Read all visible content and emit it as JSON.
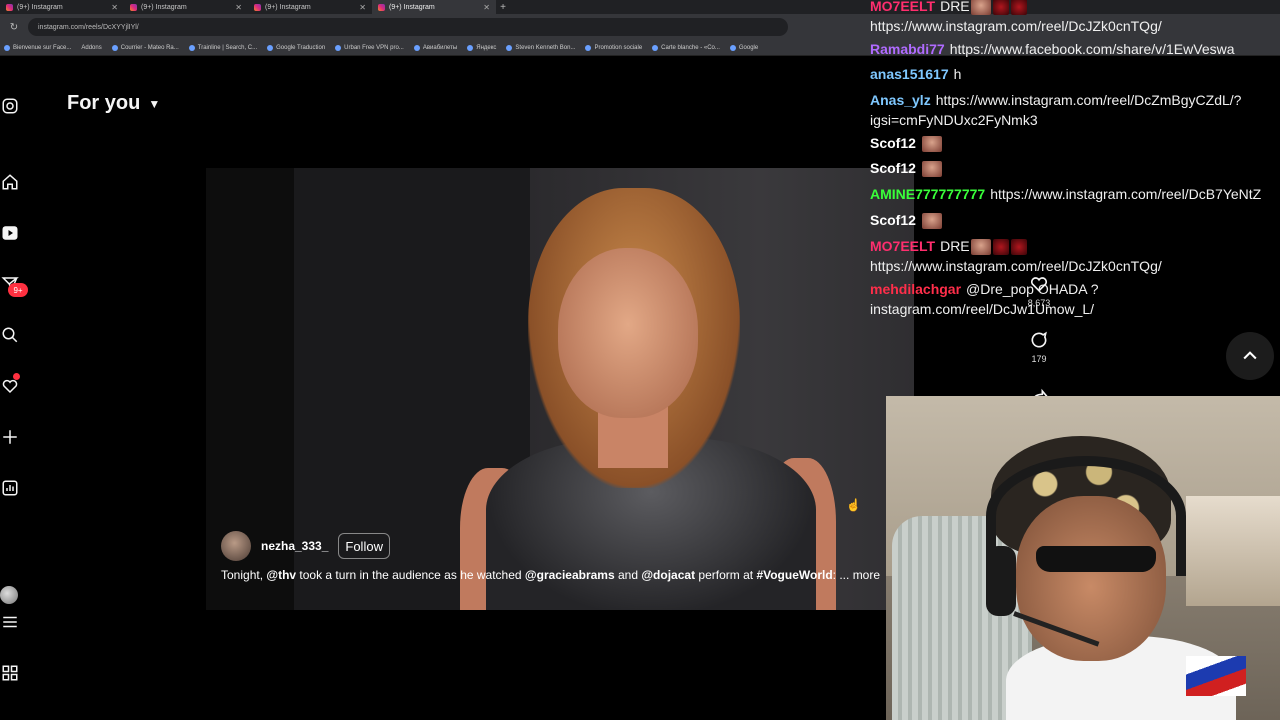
{
  "browser": {
    "tabs": [
      {
        "label": "(9+) Instagram"
      },
      {
        "label": "(9+) Instagram"
      },
      {
        "label": "(9+) Instagram"
      },
      {
        "label": "(9+) Instagram"
      }
    ],
    "new_tab": "+",
    "url": "instagram.com/reels/DcXYYjlIYl/",
    "bookmarks": [
      "Bienvenue sur Face...",
      "Addons",
      "Courrier - Mateo Ra...",
      "Trainline | Search, C...",
      "Google Traduction",
      "Urban Free VPN pro...",
      "Авиабилеты",
      "Яндекс",
      "Steven Kenneth Bon...",
      "Promotion sociale",
      "Carte blanche - «Co...",
      "Google"
    ]
  },
  "instagram": {
    "feed_title": "For you",
    "notification_badge": "9+",
    "post": {
      "username": "nezha_333_",
      "follow_label": "Follow",
      "caption": {
        "t1": "Tonight, ",
        "m1": "@thv",
        "t2": " took a turn in the audience as he watched ",
        "m2": "@gracieabrams",
        "t3": " and ",
        "m3": "@dojacat",
        "t4": " perform at ",
        "m4": "#VogueWorld",
        "t5": ": ... ",
        "more": "more"
      }
    },
    "actions": {
      "likes": "8,673",
      "comments": "179"
    }
  },
  "chat": [
    {
      "user": "MO7EELT",
      "color": "#ff2e6e",
      "msg": "DRE",
      "emotes": 3
    },
    {
      "user": "",
      "color": "#ffffff",
      "msg": "https://www.instagram.com/reel/DcJZk0cnTQg/",
      "emotes": 0
    },
    {
      "user": "Ramabdi77",
      "color": "#b06bff",
      "msg": "https://www.facebook.com/share/v/1EwVeswa",
      "emotes": 0
    },
    {
      "user": "anas151617",
      "color": "#7fc8ff",
      "msg": "h",
      "emotes": 0
    },
    {
      "user": "Anas_ylz",
      "color": "#7fc8ff",
      "msg": "https://www.instagram.com/reel/DcZmBgyCZdL/?",
      "emotes": 0
    },
    {
      "user": "",
      "color": "#ffffff",
      "msg": "igsi=cmFyNDUxc2FyNmk3",
      "emotes": 0
    },
    {
      "user": "Scof12",
      "color": "#ffffff",
      "msg": "",
      "emotes": 1
    },
    {
      "user": "Scof12",
      "color": "#ffffff",
      "msg": "",
      "emotes": 1
    },
    {
      "user": "AMINE777777777",
      "color": "#39ff3a",
      "msg": "https://www.instagram.com/reel/DcB7YeNtZ",
      "emotes": 0
    },
    {
      "user": "Scof12",
      "color": "#ffffff",
      "msg": "",
      "emotes": 1
    },
    {
      "user": "MO7EELT",
      "color": "#ff2e6e",
      "msg": "DRE",
      "emotes": 3
    },
    {
      "user": "",
      "color": "#ffffff",
      "msg": "https://www.instagram.com/reel/DcJZk0cnTQg/",
      "emotes": 0
    },
    {
      "user": "mehdilachgar",
      "color": "#ff2e4a",
      "msg": "@Dre_pop OHADA ?",
      "emotes": 0
    },
    {
      "user": "",
      "color": "#ffffff",
      "msg": "instagram.com/reel/DcJw1Umow_L/",
      "emotes": 0
    }
  ],
  "colors": {
    "accent_red": "#ff3040",
    "background": "#000000"
  }
}
